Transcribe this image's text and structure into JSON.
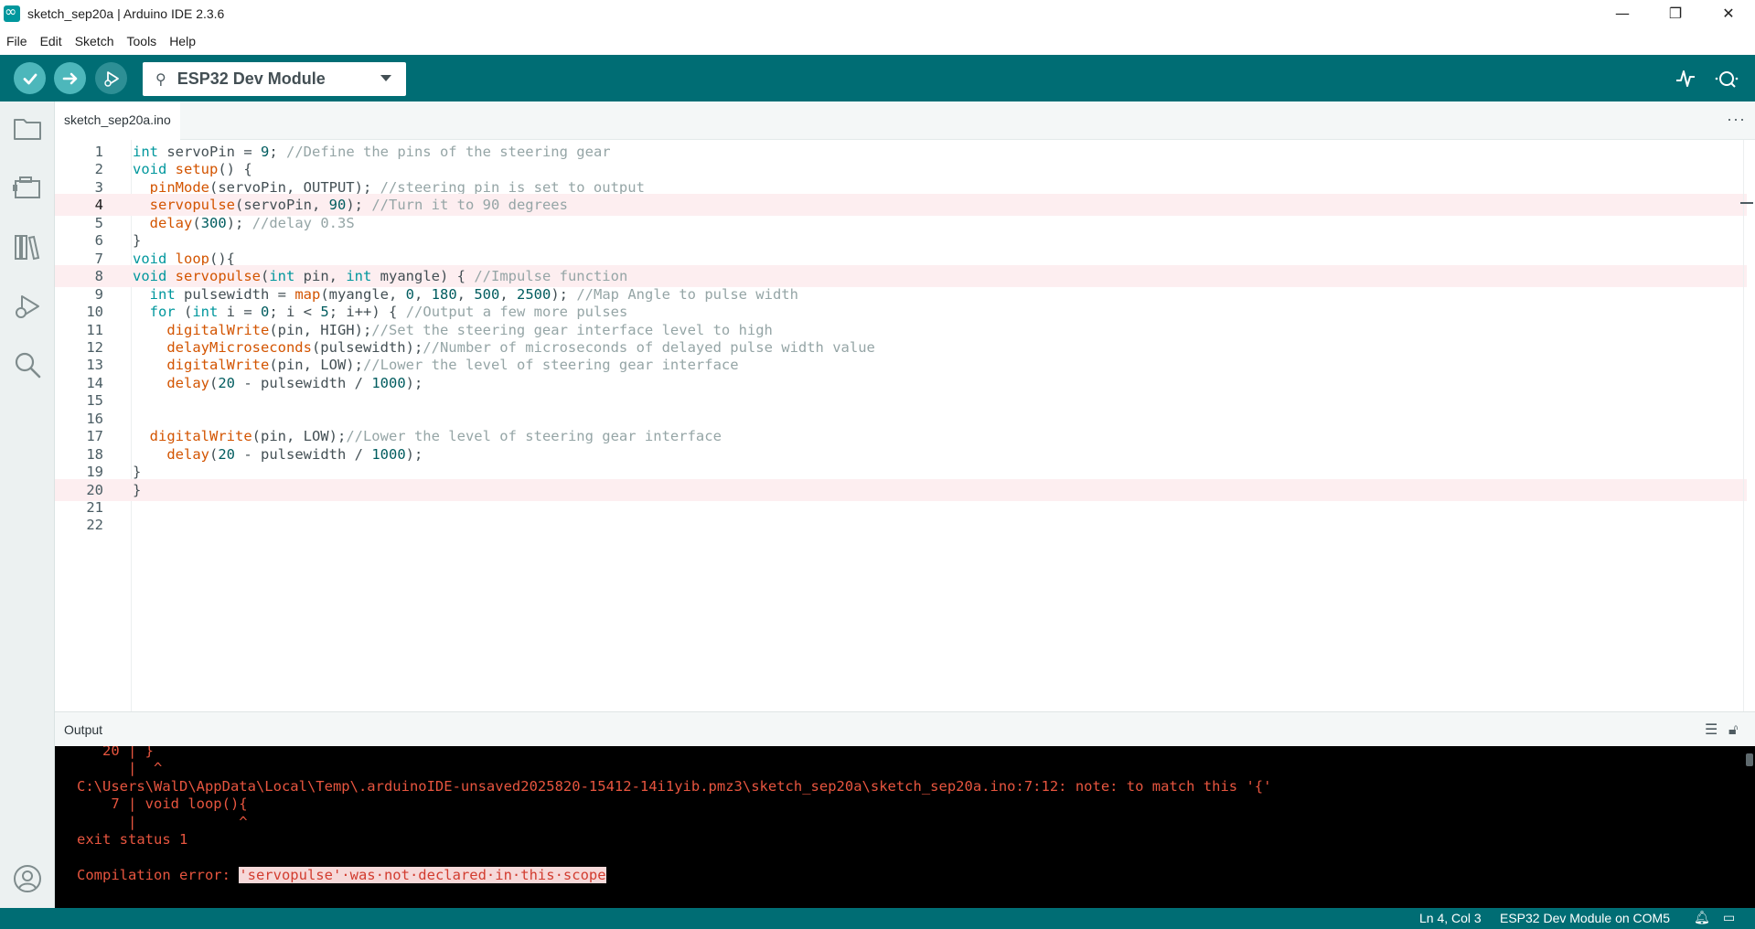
{
  "window": {
    "title": "sketch_sep20a | Arduino IDE 2.3.6",
    "controls": {
      "minimize": "—",
      "restore": "❐",
      "close": "✕"
    }
  },
  "menu": [
    "File",
    "Edit",
    "Sketch",
    "Tools",
    "Help"
  ],
  "toolbar": {
    "verify_icon": "check-icon",
    "upload_icon": "arrow-right-icon",
    "debug_icon": "debug-icon",
    "board_label": "ESP32 Dev Module",
    "serial_plotter_icon": "pulse-icon",
    "serial_monitor_icon": "magnifier-dots-icon"
  },
  "sidebar": [
    "folder-icon",
    "board-icon",
    "library-icon",
    "debug-icon",
    "search-icon",
    "account-icon"
  ],
  "tab": {
    "filename": "sketch_sep20a.ino",
    "more": "···"
  },
  "editor": {
    "active_line": 4,
    "lines": [
      {
        "n": "1",
        "text": "int servoPin = 9; //Define the pins of the steering gear"
      },
      {
        "n": "2",
        "text": "void setup() {"
      },
      {
        "n": "3",
        "text": "  pinMode(servoPin, OUTPUT); //steering pin is set to output"
      },
      {
        "n": "4",
        "text": "  servopulse(servoPin, 90); //Turn it to 90 degrees"
      },
      {
        "n": "5",
        "text": "  delay(300); //delay 0.3S"
      },
      {
        "n": "6",
        "text": "}"
      },
      {
        "n": "7",
        "text": "void loop(){"
      },
      {
        "n": "8",
        "text": "void servopulse(int pin, int myangle) { //Impulse function"
      },
      {
        "n": "9",
        "text": "  int pulsewidth = map(myangle, 0, 180, 500, 2500); //Map Angle to pulse width"
      },
      {
        "n": "10",
        "text": "  for (int i = 0; i < 5; i++) { //Output a few more pulses"
      },
      {
        "n": "11",
        "text": "    digitalWrite(pin, HIGH);//Set the steering gear interface level to high"
      },
      {
        "n": "12",
        "text": "    delayMicroseconds(pulsewidth);//Number of microseconds of delayed pulse width value"
      },
      {
        "n": "13",
        "text": "    digitalWrite(pin, LOW);//Lower the level of steering gear interface"
      },
      {
        "n": "14",
        "text": "    delay(20 - pulsewidth / 1000);"
      },
      {
        "n": "15",
        "text": ""
      },
      {
        "n": "16",
        "text": ""
      },
      {
        "n": "17",
        "text": "  digitalWrite(pin, LOW);//Lower the level of steering gear interface"
      },
      {
        "n": "18",
        "text": "    delay(20 - pulsewidth / 1000);"
      },
      {
        "n": "19",
        "text": "}"
      },
      {
        "n": "20",
        "text": "}"
      },
      {
        "n": "21",
        "text": ""
      },
      {
        "n": "22",
        "text": ""
      }
    ]
  },
  "output": {
    "label": "Output",
    "lines": [
      "   20 | }",
      "      |  ^",
      "C:\\Users\\WalD\\AppData\\Local\\Temp\\.arduinoIDE-unsaved2025820-15412-14i1yib.pmz3\\sketch_sep20a\\sketch_sep20a.ino:7:12: note: to match this '{'",
      "    7 | void loop(){",
      "      |            ^",
      "exit status 1",
      "",
      "Compilation error: "
    ],
    "error_highlight": "'servopulse'·was·not·declared·in·this·scope"
  },
  "status": {
    "position": "Ln 4, Col 3",
    "board_port": "ESP32 Dev Module on COM5"
  },
  "colors": {
    "teal": "#006d74",
    "keyword": "#00979d",
    "function": "#d35400",
    "comment": "#95a5a6",
    "error": "#e7553f"
  }
}
